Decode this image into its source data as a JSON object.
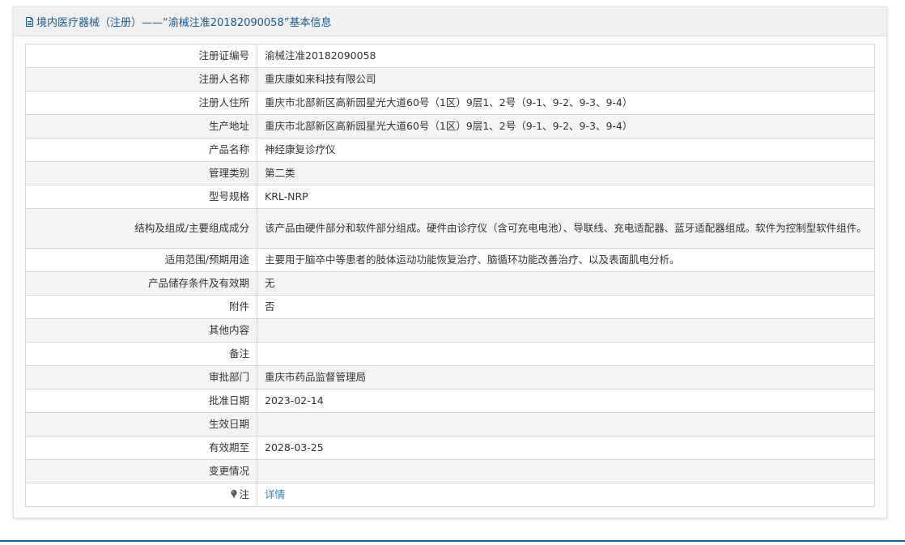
{
  "header": {
    "title": "境内医疗器械（注册）——“渝械注准20182090058”基本信息",
    "icon": "document-icon"
  },
  "rows": [
    {
      "label": "注册证编号",
      "value": "渝械注准20182090058"
    },
    {
      "label": "注册人名称",
      "value": "重庆康如来科技有限公司"
    },
    {
      "label": "注册人住所",
      "value": "重庆市北部新区高新园星光大道60号（1区）9层1、2号（9-1、9-2、9-3、9-4）"
    },
    {
      "label": "生产地址",
      "value": "重庆市北部新区高新园星光大道60号（1区）9层1、2号（9-1、9-2、9-3、9-4）"
    },
    {
      "label": "产品名称",
      "value": "神经康复诊疗仪"
    },
    {
      "label": "管理类别",
      "value": "第二类"
    },
    {
      "label": "型号规格",
      "value": "KRL-NRP"
    },
    {
      "label": "结构及组成/主要组成成分",
      "value": "该产品由硬件部分和软件部分组成。硬件由诊疗仪（含可充电电池）、导联线、充电适配器、蓝牙适配器组成。软件为控制型软件组件。"
    },
    {
      "label": "适用范围/预期用途",
      "value": "主要用于脑卒中等患者的肢体运动功能恢复治疗、脑循环功能改善治疗、以及表面肌电分析。"
    },
    {
      "label": "产品储存条件及有效期",
      "value": "无"
    },
    {
      "label": "附件",
      "value": "否"
    },
    {
      "label": "其他内容",
      "value": ""
    },
    {
      "label": "备注",
      "value": ""
    },
    {
      "label": "审批部门",
      "value": "重庆市药品监督管理局"
    },
    {
      "label": "批准日期",
      "value": "2023-02-14"
    },
    {
      "label": "生效日期",
      "value": ""
    },
    {
      "label": "有效期至",
      "value": "2028-03-25"
    },
    {
      "label": "变更情况",
      "value": ""
    }
  ],
  "note_row": {
    "label": "注",
    "icon": "pin-icon",
    "link_text": "详情"
  },
  "colors": {
    "header_text": "#1d5a8d",
    "link": "#3a7fc0",
    "alt_row_bg": "#f4f4f4",
    "border": "#d6d6d6"
  }
}
